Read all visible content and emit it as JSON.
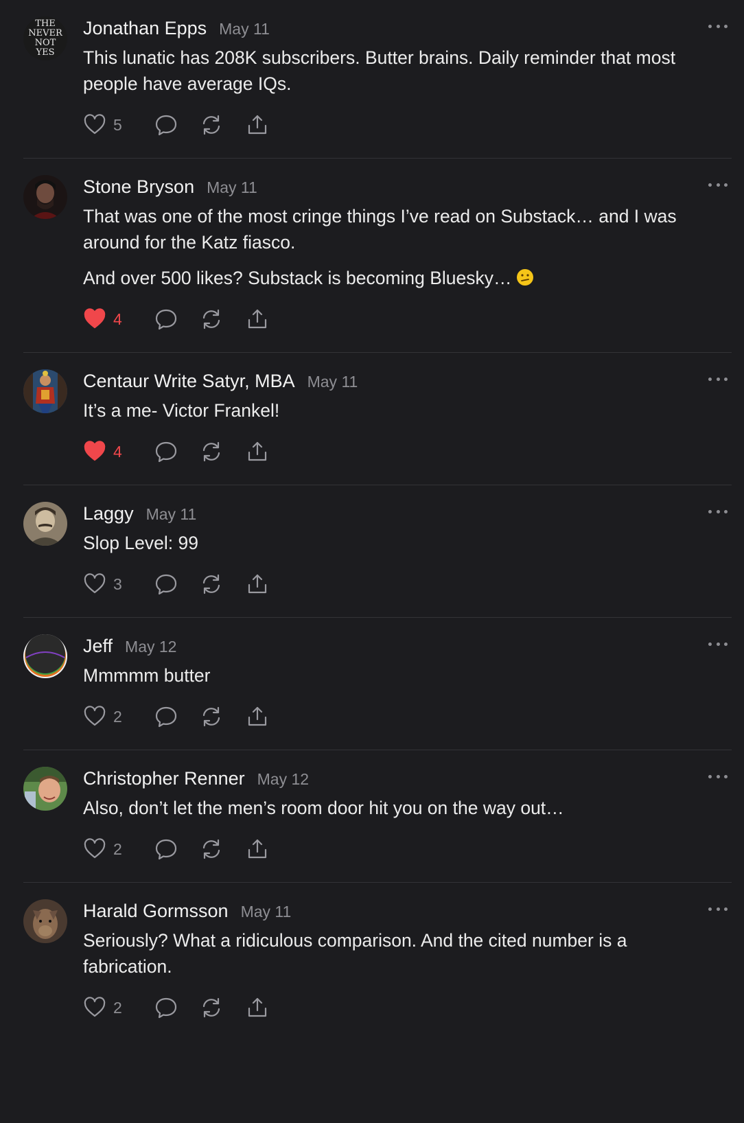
{
  "colors": {
    "background": "#1c1c1f",
    "divider": "#333337",
    "muted": "#8e8e93",
    "liked": "#f0474b"
  },
  "comments": [
    {
      "author": "Jonathan Epps",
      "date": "May 11",
      "paragraphs": [
        "This lunatic has 208K subscribers. Butter brains. Daily reminder that most people have average IQs."
      ],
      "likes": "5",
      "liked": false,
      "avatar_text": [
        "THE",
        "NEVER",
        "NOT",
        "YES"
      ]
    },
    {
      "author": "Stone Bryson",
      "date": "May 11",
      "paragraphs": [
        "That was one of the most cringe things I’ve read on Substack… and I was around for the Katz fiasco.",
        "And over 500 likes? Substack is becoming Bluesky…"
      ],
      "likes": "4",
      "liked": true
    },
    {
      "author": "Centaur Write Satyr, MBA",
      "date": "May 11",
      "paragraphs": [
        "It’s a me- Victor Frankel!"
      ],
      "likes": "4",
      "liked": true
    },
    {
      "author": "Laggy",
      "date": "May 11",
      "paragraphs": [
        "Slop Level: 99"
      ],
      "likes": "3",
      "liked": false
    },
    {
      "author": "Jeff",
      "date": "May 12",
      "paragraphs": [
        "Mmmmm butter"
      ],
      "likes": "2",
      "liked": false
    },
    {
      "author": "Christopher Renner",
      "date": "May 12",
      "paragraphs": [
        "Also, don’t let the men’s room door hit you on the way out…"
      ],
      "likes": "2",
      "liked": false
    },
    {
      "author": "Harald Gormsson",
      "date": "May 11",
      "paragraphs": [
        "Seriously? What a ridiculous comparison. And the cited number is a fabrication."
      ],
      "likes": "2",
      "liked": false
    }
  ],
  "icons": {
    "like": "heart-icon",
    "reply": "comment-bubble-icon",
    "restack": "restack-icon",
    "share": "share-icon",
    "more": "more-dots-icon",
    "emoji": "confused-face-emoji"
  }
}
